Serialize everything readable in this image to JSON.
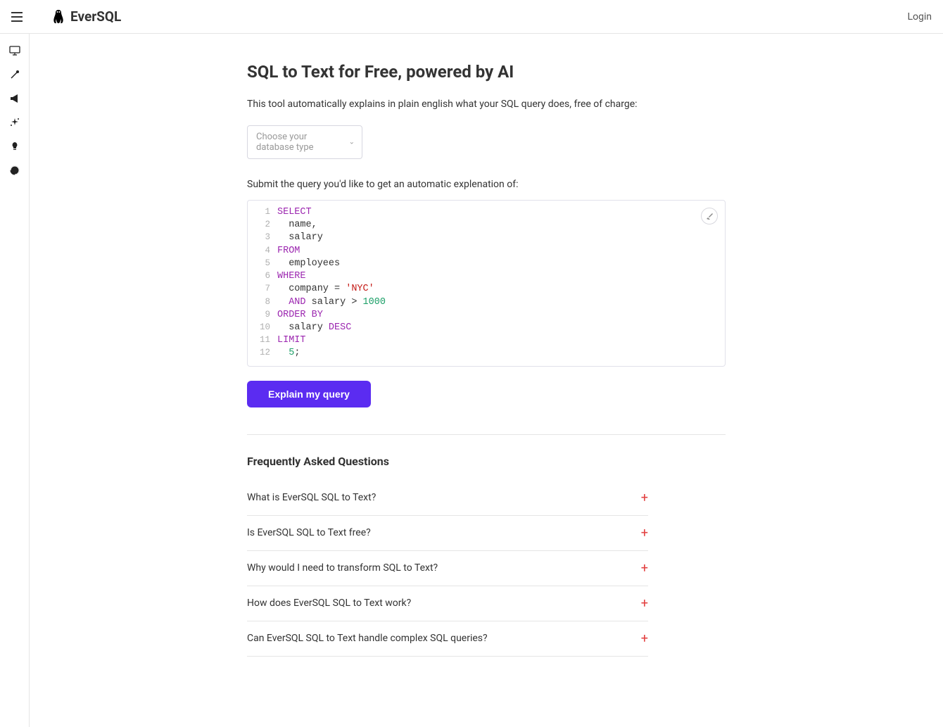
{
  "header": {
    "brand": "EverSQL",
    "login_label": "Login"
  },
  "page": {
    "title": "SQL to Text for Free, powered by AI",
    "description": "This tool automatically explains in plain english what your SQL query does, free of charge:",
    "db_select_placeholder": "Choose your database type",
    "submit_label": "Submit the query you'd like to get an automatic explenation of:",
    "explain_button": "Explain my query"
  },
  "code": {
    "lines": [
      {
        "num": "1",
        "tokens": [
          {
            "t": "SELECT",
            "c": "kw"
          }
        ]
      },
      {
        "num": "2",
        "tokens": [
          {
            "t": "  name,",
            "c": ""
          }
        ]
      },
      {
        "num": "3",
        "tokens": [
          {
            "t": "  salary",
            "c": ""
          }
        ]
      },
      {
        "num": "4",
        "tokens": [
          {
            "t": "FROM",
            "c": "kw"
          }
        ]
      },
      {
        "num": "5",
        "tokens": [
          {
            "t": "  employees",
            "c": ""
          }
        ]
      },
      {
        "num": "6",
        "tokens": [
          {
            "t": "WHERE",
            "c": "kw"
          }
        ]
      },
      {
        "num": "7",
        "tokens": [
          {
            "t": "  company = ",
            "c": ""
          },
          {
            "t": "'NYC'",
            "c": "str"
          }
        ]
      },
      {
        "num": "8",
        "tokens": [
          {
            "t": "  ",
            "c": ""
          },
          {
            "t": "AND",
            "c": "kw"
          },
          {
            "t": " salary > ",
            "c": ""
          },
          {
            "t": "1000",
            "c": "num"
          }
        ]
      },
      {
        "num": "9",
        "tokens": [
          {
            "t": "ORDER BY",
            "c": "kw"
          }
        ]
      },
      {
        "num": "10",
        "tokens": [
          {
            "t": "  salary ",
            "c": ""
          },
          {
            "t": "DESC",
            "c": "kw"
          }
        ]
      },
      {
        "num": "11",
        "tokens": [
          {
            "t": "LIMIT",
            "c": "kw"
          }
        ]
      },
      {
        "num": "12",
        "tokens": [
          {
            "t": "  ",
            "c": ""
          },
          {
            "t": "5",
            "c": "num"
          },
          {
            "t": ";",
            "c": ""
          }
        ]
      }
    ]
  },
  "faq": {
    "title": "Frequently Asked Questions",
    "items": [
      "What is EverSQL SQL to Text?",
      "Is EverSQL SQL to Text free?",
      "Why would I need to transform SQL to Text?",
      "How does EverSQL SQL to Text work?",
      "Can EverSQL SQL to Text handle complex SQL queries?"
    ]
  }
}
